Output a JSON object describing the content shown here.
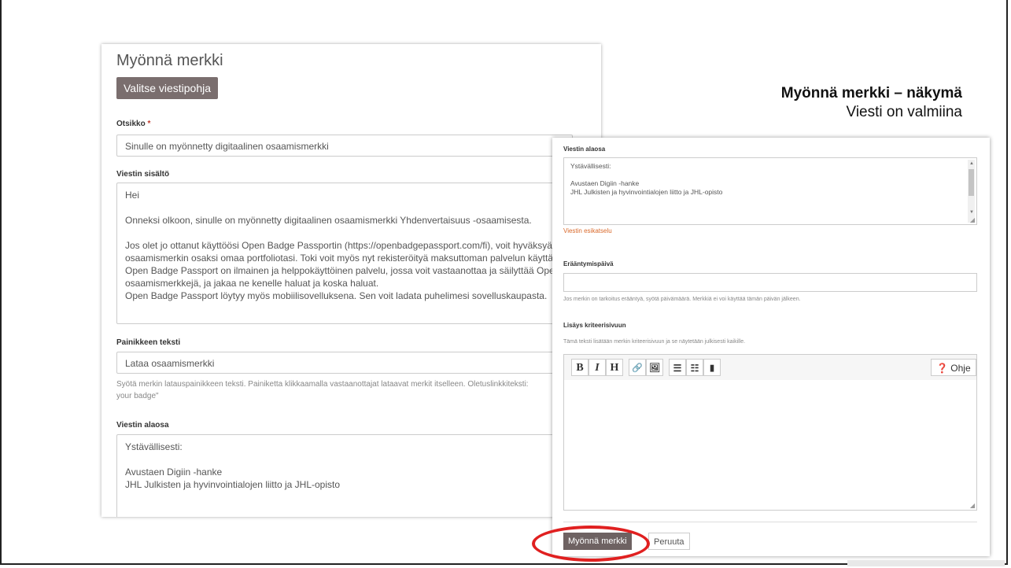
{
  "caption": {
    "title": "Myönnä merkki – näkymä",
    "subtitle": "Viesti on valmiina"
  },
  "left_panel": {
    "title": "Myönnä merkki",
    "template_button": "Valitse viestipohja",
    "subject": {
      "label": "Otsikko",
      "required_mark": "*",
      "value": "Sinulle on myönnetty digitaalinen osaamismerkki"
    },
    "message": {
      "label": "Viestin sisältö",
      "lines": [
        "Hei",
        "",
        "Onneksi olkoon, sinulle on myönnetty digitaalinen osaamismerkki Yhdenvertaisuus -osaamisesta.",
        "",
        "Jos olet jo ottanut käyttöösi Open Badge Passportin (https://openbadgepassport.com/fi), voit hyväksyä",
        "osaamismerkin osaksi omaa portfoliotasi. Toki voit myös nyt rekisteröityä maksuttoman palvelun käyttäjäksi:",
        "Open Badge Passport on ilmainen ja helppokäyttöinen palvelu, jossa voit vastaanottaa ja säilyttää Open Badg",
        "osaamismerkkejä, ja jakaa ne kenelle haluat ja koska haluat.",
        "Open Badge Passport löytyy myös mobiilisovelluksena. Sen voit ladata puhelimesi sovelluskaupasta."
      ]
    },
    "button_text": {
      "label": "Painikkeen teksti",
      "value": "Lataa osaamismerkki",
      "help_line1": "Syötä merkin latauspainikkeen teksti. Painiketta klikkaamalla vastaanottajat lataavat merkit itselleen. Oletuslinkkiteksti:",
      "help_line2": "your badge\""
    },
    "footer": {
      "label": "Viestin alaosa",
      "lines": [
        "Ystävällisesti:",
        "",
        "Avustaen Digiin -hanke",
        "JHL Julkisten ja hyvinvointialojen liitto ja JHL-opisto"
      ]
    }
  },
  "right_panel": {
    "footer": {
      "label": "Viestin alaosa",
      "lines": [
        "Ystävällisesti:",
        "",
        "Avustaen Digiin -hanke",
        "JHL Julkisten ja hyvinvointialojen liitto ja JHL-opisto"
      ],
      "preview_link": "Viestin esikatselu"
    },
    "expiry": {
      "label": "Erääntymispäivä",
      "value": "",
      "help": "Jos merkin on tarkoitus erääntyä, syötä päivämäärä. Merkkiä ei voi käyttää tämän päivän jälkeen."
    },
    "criteria": {
      "label": "Lisäys kriteerisivuun",
      "help": "Tämä teksti lisätään merkin kriteerisivuun ja se näytetään julkisesti kaikille.",
      "toolbar": {
        "bold": "B",
        "italic": "I",
        "heading": "H",
        "link": "🔗",
        "image": "🖼",
        "ul": "☰",
        "ol": "☷",
        "quote": "▮",
        "help": "Ohje",
        "help_icon": "❓"
      }
    },
    "issue_button": "Myönnä merkki",
    "cancel_button": "Peruuta"
  }
}
